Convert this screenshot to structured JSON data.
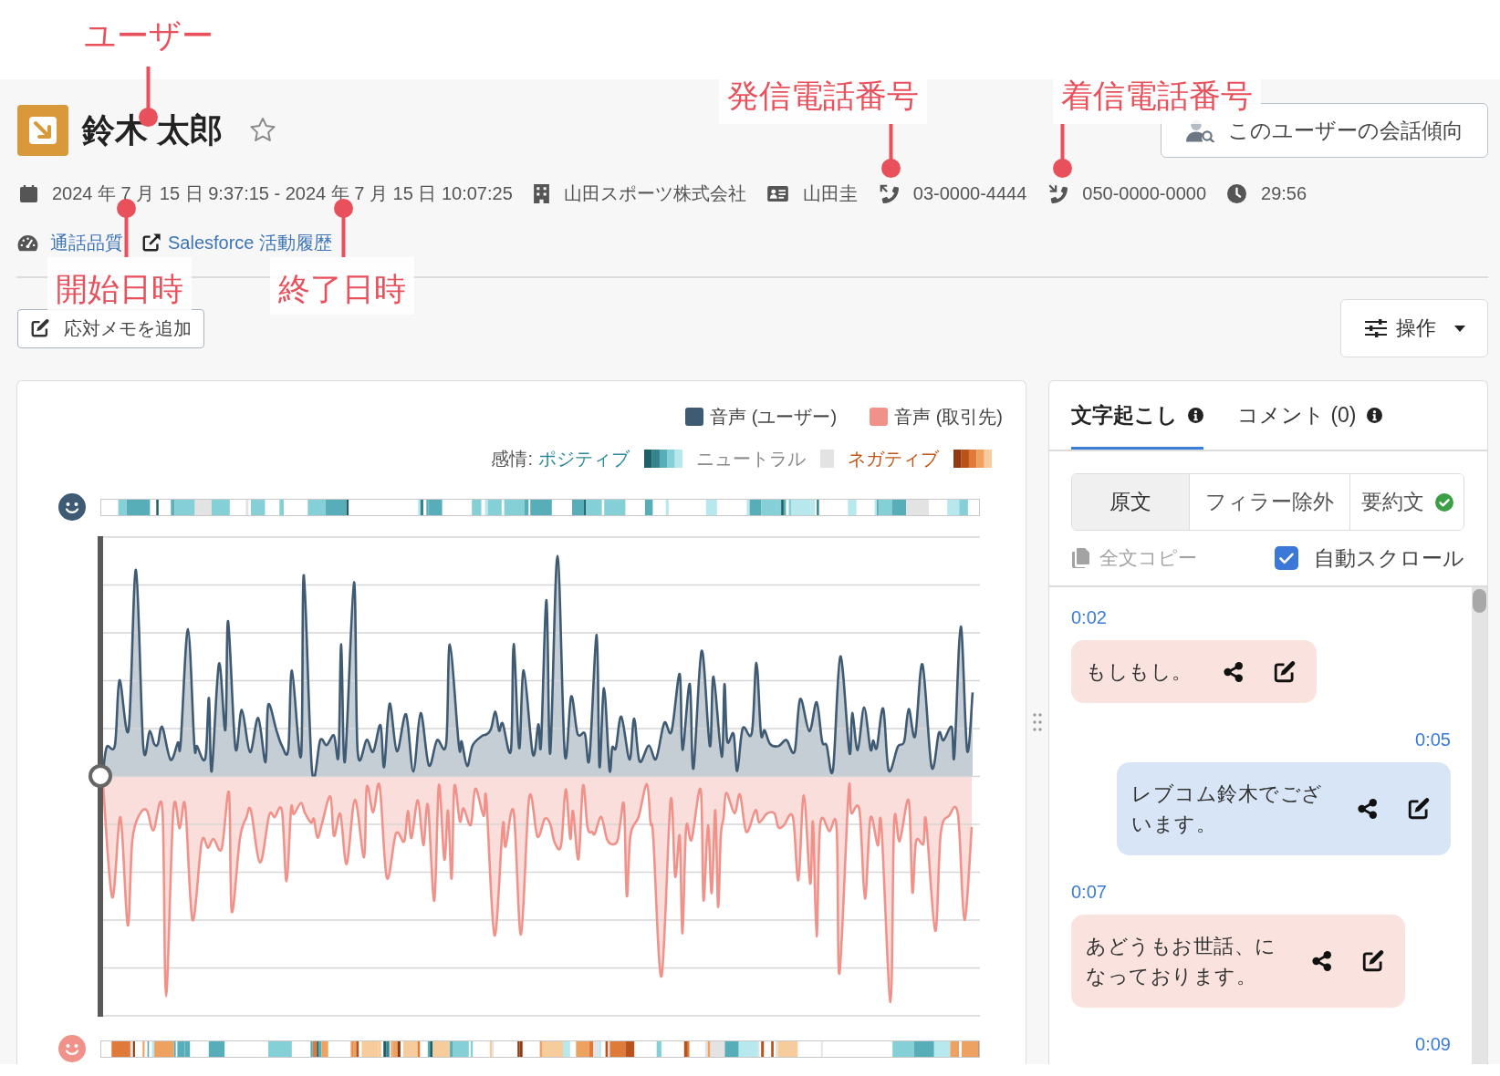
{
  "annotations": [
    {
      "label": "ユーザー",
      "kind": "user_name"
    },
    {
      "label": "発信電話番号",
      "kind": "outgoing_number"
    },
    {
      "label": "着信電話番号",
      "kind": "incoming_number"
    },
    {
      "label": "開始日時",
      "kind": "start_time"
    },
    {
      "label": "終了日時",
      "kind": "end_time"
    }
  ],
  "header": {
    "user_name": "鈴木 太郎",
    "starred": false,
    "trend_button": "このユーザーの会話傾向"
  },
  "meta": [
    {
      "kind": "period",
      "text": "2024 年 7 月 15 日 9:37:15 - 2024 年 7 月 15 日 10:07:25"
    },
    {
      "kind": "company",
      "text": "山田スポーツ株式会社"
    },
    {
      "kind": "contact",
      "text": "山田圭"
    },
    {
      "kind": "outgoing",
      "text": "03-0000-4444"
    },
    {
      "kind": "incoming",
      "text": "050-0000-0000"
    },
    {
      "kind": "duration",
      "text": "29:56"
    }
  ],
  "links": [
    {
      "kind": "quality",
      "label": "通話品質"
    },
    {
      "kind": "external",
      "label": "Salesforce 活動履歴"
    }
  ],
  "actions": {
    "memo_button": "応対メモを追加",
    "operations_button": "操作"
  },
  "chart": {
    "voice_legend": [
      {
        "label": "音声 (ユーザー)",
        "color": "#3f5a73"
      },
      {
        "label": "音声 (取引先)",
        "color": "#f0928a"
      }
    ],
    "sentiment_title": "感情:",
    "sentiment_legend": [
      {
        "label": "ポジティブ",
        "kind": "positive"
      },
      {
        "label": "ニュートラル",
        "kind": "neutral"
      },
      {
        "label": "ネガティブ",
        "kind": "negative"
      }
    ]
  },
  "transcript_panel": {
    "tabs": [
      {
        "label": "文字起こし",
        "selected": true
      },
      {
        "label": "コメント (0)",
        "selected": false
      }
    ],
    "modes": [
      {
        "label": "原文",
        "selected": true,
        "done": false
      },
      {
        "label": "フィラー除外",
        "selected": false,
        "done": false
      },
      {
        "label": "要約文",
        "selected": false,
        "done": true
      }
    ],
    "copy_button": {
      "label": "全文コピー",
      "disabled": true
    },
    "auto_scroll": {
      "label": "自動スクロール",
      "checked": true
    },
    "messages": [
      {
        "time": "0:02",
        "kind": "client",
        "text": "もしもし。"
      },
      {
        "time": "0:05",
        "kind": "user",
        "text": "レブコム鈴木でございます。"
      },
      {
        "time": "0:07",
        "kind": "client",
        "text": "あどうもお世話、になっております。"
      },
      {
        "time": "0:09",
        "kind": "user"
      }
    ]
  }
}
